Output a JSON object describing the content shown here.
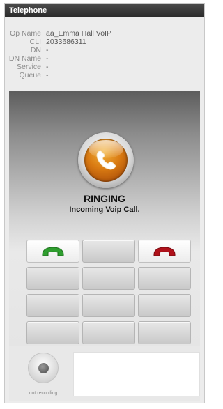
{
  "window": {
    "title": "Telephone"
  },
  "info": {
    "rows": [
      {
        "key": "Op Name",
        "value": "aa_Emma Hall VoIP"
      },
      {
        "key": "CLI",
        "value": "2033686311"
      },
      {
        "key": "DN",
        "value": "-"
      },
      {
        "key": "DN Name",
        "value": "-"
      },
      {
        "key": "Service",
        "value": "-"
      },
      {
        "key": "Queue",
        "value": "-"
      }
    ]
  },
  "call": {
    "status": "RINGING",
    "message": "Incoming Voip Call.",
    "icon": "phone-handset-icon"
  },
  "keypad": {
    "answer_icon": "answer-call-icon",
    "hangup_icon": "hangup-call-icon",
    "colors": {
      "answer": "#2f9e2f",
      "hangup": "#b0121b",
      "orb": "#d97a12"
    }
  },
  "recorder": {
    "label": "not recording",
    "icon": "record-icon"
  }
}
